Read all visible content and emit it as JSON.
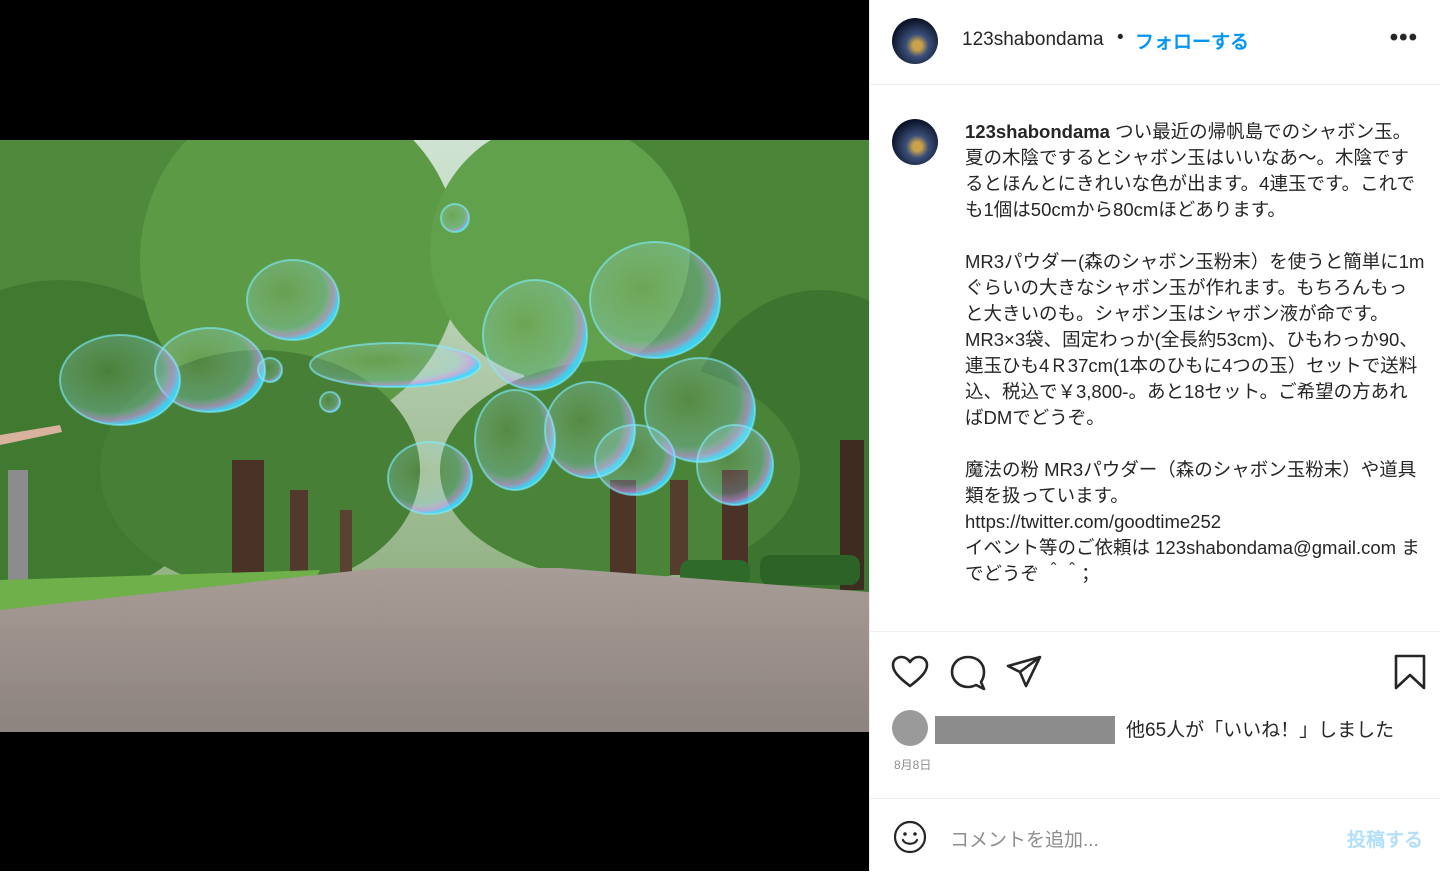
{
  "post": {
    "username": "123shabondama",
    "separator": "•",
    "follow_label": "フォローする",
    "more_label": "•••",
    "caption_username": "123shabondama",
    "caption_text": " つい最近の帰帆島でのシャボン玉。夏の木陰でするとシャボン玉はいいなあ〜。木陰でするとほんとにきれいな色が出ます。4連玉です。これでも1個は50cmから80cmほどあります。\n\nMR3パウダー(森のシャボン玉粉末）を使うと簡単に1mぐらいの大きなシャボン玉が作れます。もちろんもっと大きいのも。シャボン玉はシャボン液が命です。\nMR3×3袋、固定わっか(全長約53cm)、ひもわっか90、連玉ひも4Ｒ37cm(1本のひもに4つの玉）セットで送料込、税込で￥3,800-。あと18セット。ご希望の方あればDMでどうぞ。\n\n魔法の粉 MR3パウダー（森のシャボン玉粉末）や道具類を扱っています。\nhttps://twitter.com/goodtime252\nイベント等のご依頼は 123shabondama@gmail.com までどうぞ ＾＾；",
    "likes_text": "他65人が「いいね！」しました",
    "date": "8月8日",
    "comment_placeholder": "コメントを追加...",
    "post_button": "投稿する"
  },
  "icons": {
    "more": "more-icon",
    "like": "heart-icon",
    "comment": "comment-icon",
    "share": "share-icon",
    "save": "bookmark-icon",
    "emoji": "emoji-icon"
  },
  "colors": {
    "accent": "#0095f6",
    "post_disabled": "#b2dffc",
    "muted": "#8e8e8e"
  }
}
